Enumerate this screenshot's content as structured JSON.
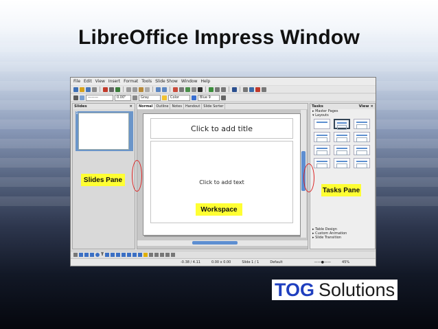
{
  "slide": {
    "title": "LibreOffice Impress Window"
  },
  "app": {
    "menu": [
      "File",
      "Edit",
      "View",
      "Insert",
      "Format",
      "Tools",
      "Slide Show",
      "Window",
      "Help"
    ],
    "toolbar2": {
      "line_width": "0.00\"",
      "line_color": "Gray",
      "area_style": "Color",
      "area_color": "Blue 9"
    },
    "slides_pane": {
      "title": "Slides",
      "thumb_number": "1"
    },
    "view_tabs": [
      "Normal",
      "Outline",
      "Notes",
      "Handout",
      "Slide Sorter"
    ],
    "active_view": "Normal",
    "placeholders": {
      "title": "Click to add title",
      "body": "Click to add text"
    },
    "tasks_pane": {
      "title": "Tasks",
      "view_label": "View",
      "sections_top": [
        "Master Pages",
        "Layouts"
      ],
      "sections_bottom": [
        "Table Design",
        "Custom Animation",
        "Slide Transition"
      ],
      "layout_count": 12,
      "selected_layout": 2
    },
    "status": {
      "position": "-0.38 / 4.11",
      "size": "0.00 x 0.00",
      "slide": "Slide 1 / 1",
      "master": "Default",
      "zoom": "45%"
    }
  },
  "annotations": {
    "slides_pane": "Slides Pane",
    "tasks_pane": "Tasks Pane",
    "workspace": "Workspace",
    "highlight_color": "#ffff33",
    "circle_color": "#dd2222"
  },
  "logo": {
    "part1": "TOG",
    "part2": "Solutions",
    "part1_color": "#1f3fbf"
  }
}
